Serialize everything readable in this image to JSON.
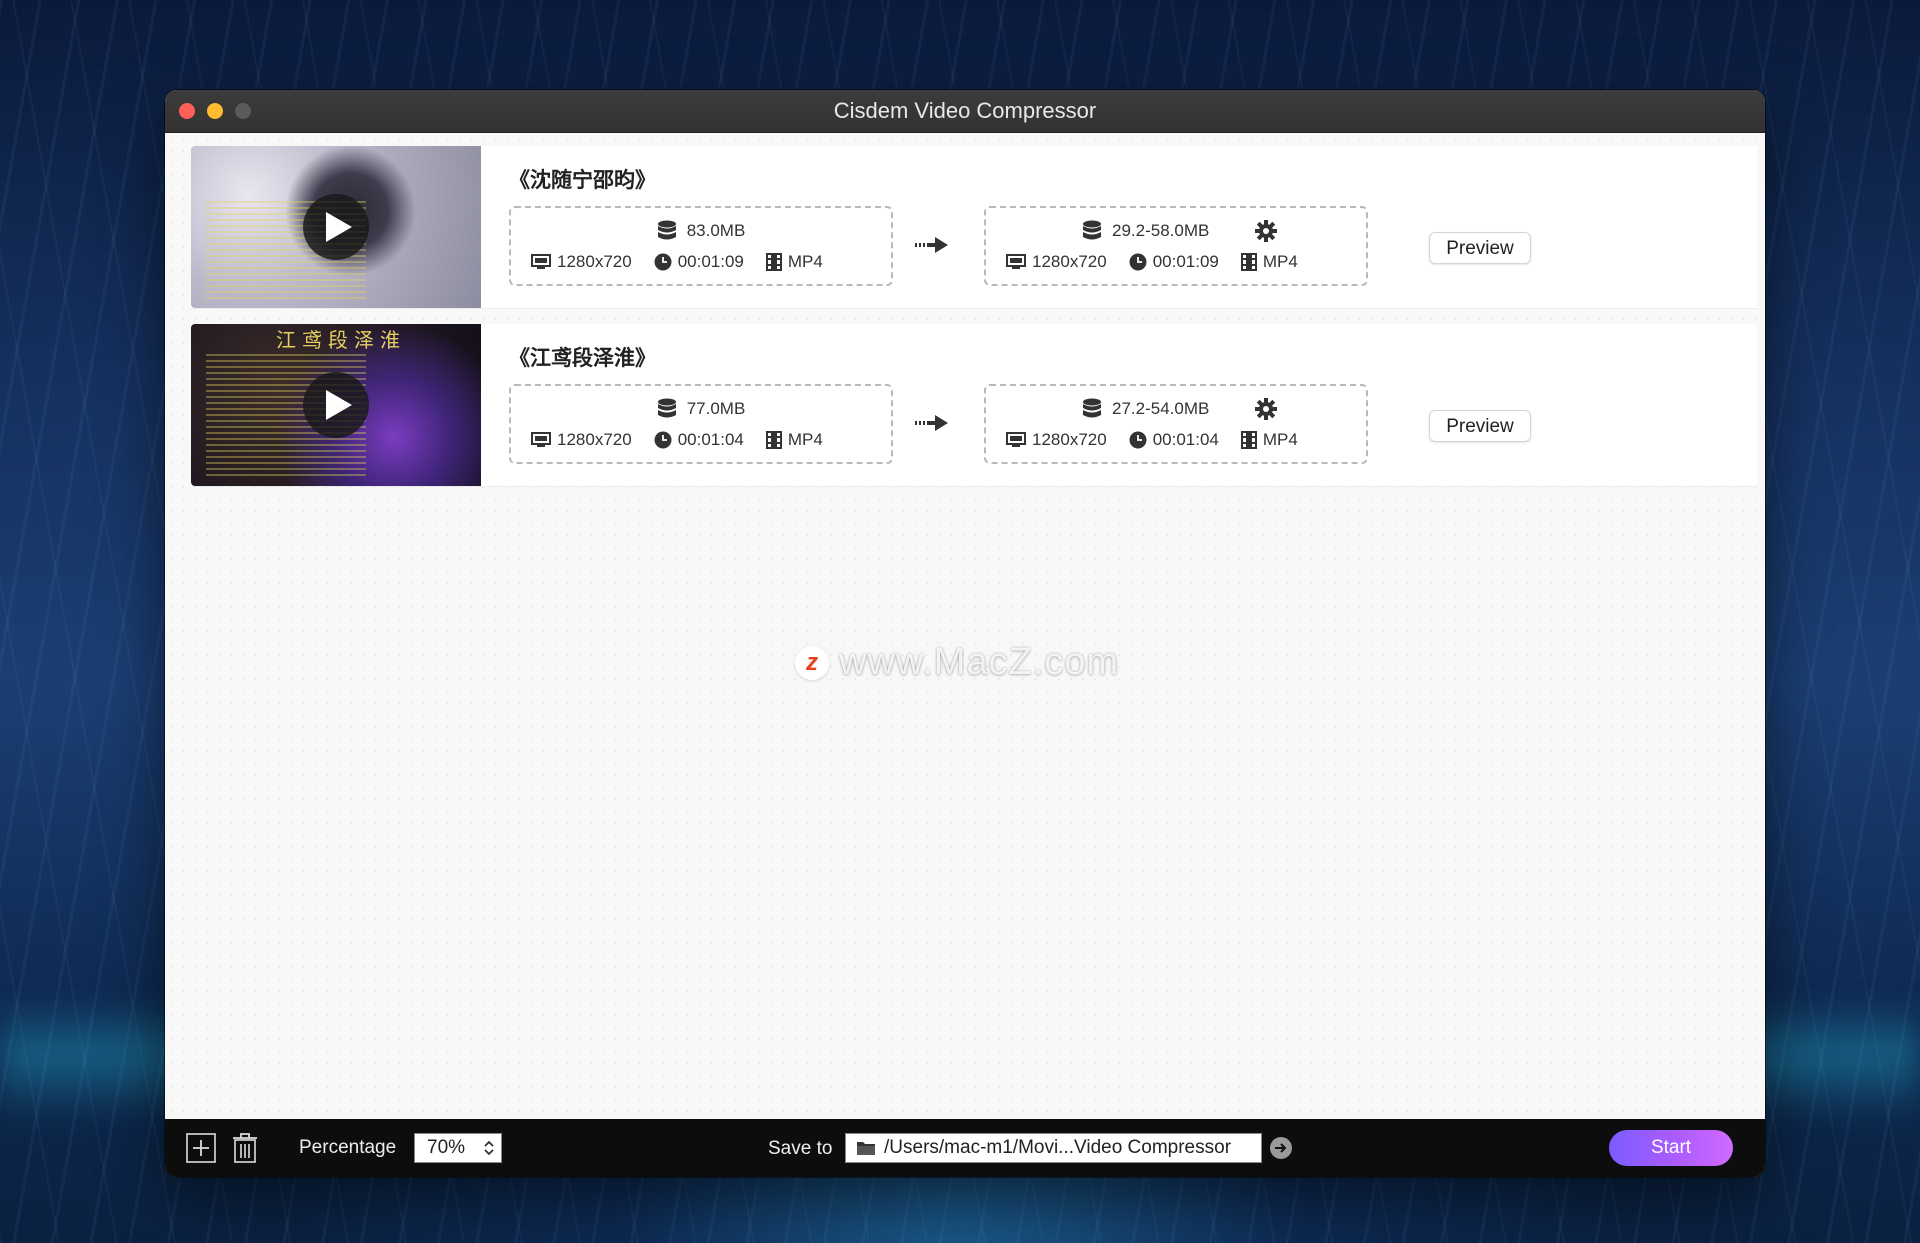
{
  "window": {
    "title": "Cisdem Video Compressor"
  },
  "items": [
    {
      "name": "《沈随宁邵昀》",
      "thumb_caption": "",
      "source": {
        "size": "83.0MB",
        "resolution": "1280x720",
        "duration": "00:01:09",
        "format": "MP4"
      },
      "output": {
        "size": "29.2-58.0MB",
        "resolution": "1280x720",
        "duration": "00:01:09",
        "format": "MP4"
      },
      "preview_label": "Preview"
    },
    {
      "name": "《江鸢段泽淮》",
      "thumb_caption": "江鸢段泽淮",
      "source": {
        "size": "77.0MB",
        "resolution": "1280x720",
        "duration": "00:01:04",
        "format": "MP4"
      },
      "output": {
        "size": "27.2-54.0MB",
        "resolution": "1280x720",
        "duration": "00:01:04",
        "format": "MP4"
      },
      "preview_label": "Preview"
    }
  ],
  "watermark": {
    "letter": "z",
    "text": "www.MacZ.com"
  },
  "bottom": {
    "percentage_label": "Percentage",
    "percentage_value": "70%",
    "save_to_label": "Save to",
    "save_path": "/Users/mac-m1/Movi...Video Compressor",
    "start_label": "Start"
  },
  "colors": {
    "accent_start": "#7b5cff",
    "accent_end": "#d06bff",
    "close": "#ff5f57",
    "minimize": "#febc2e"
  },
  "icons": [
    "database-icon",
    "monitor-icon",
    "clock-icon",
    "film-icon",
    "gear-icon",
    "arrow-right-icon",
    "play-icon",
    "add-icon",
    "trash-icon",
    "folder-icon",
    "go-arrow-icon",
    "stepper-icon"
  ]
}
